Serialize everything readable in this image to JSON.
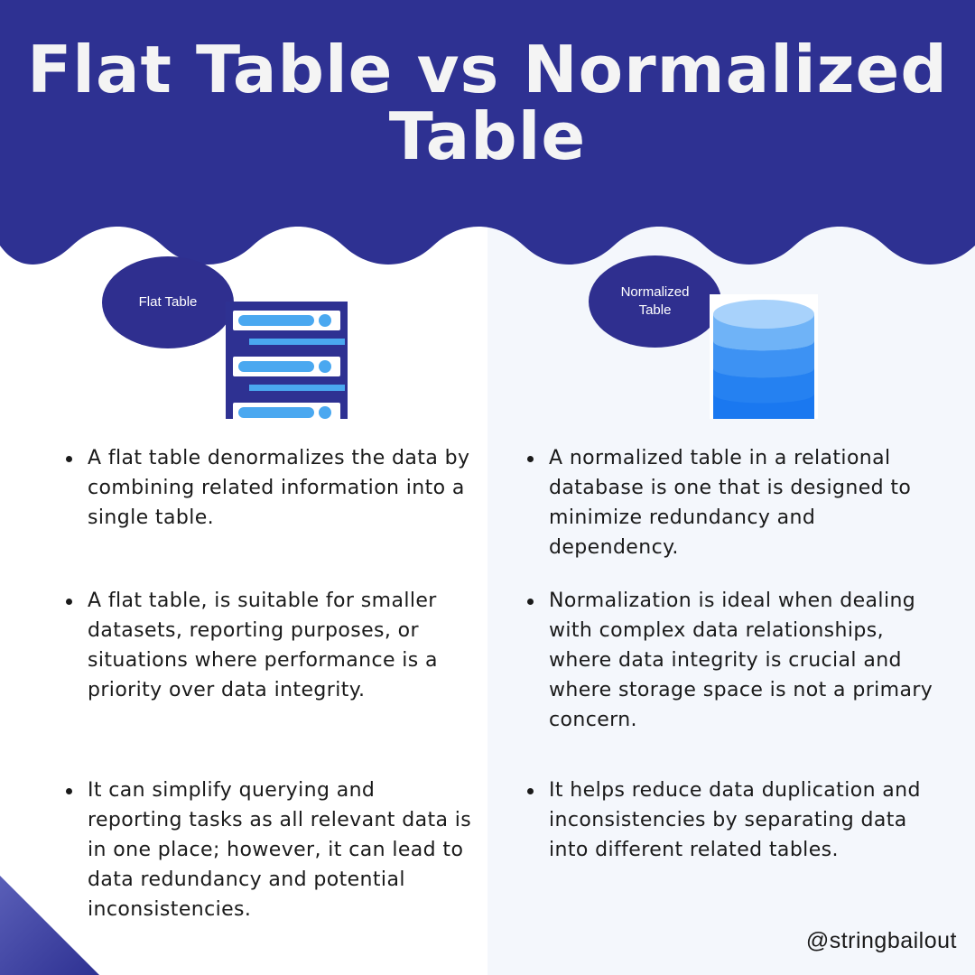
{
  "title": "Flat Table vs Normalized Table",
  "colors": {
    "header_bg": "#2e3192",
    "bubble_bg": "#2f2f8f",
    "right_panel_bg": "#f4f7fc",
    "server_frame": "#2e3192",
    "server_bar": "#4aa8f0",
    "db_top": "#a8d2fb",
    "db_body": "#1a78f0"
  },
  "left": {
    "label": "Flat Table",
    "icon": "server-rack-icon",
    "bullets": [
      "A flat table denormalizes the data by combining related information into a single table.",
      "A flat table, is suitable for smaller datasets, reporting purposes, or situations where performance is a priority over data integrity.",
      "It can simplify querying and reporting tasks as all relevant data is in one place; however, it can lead to data redundancy and potential inconsistencies."
    ]
  },
  "right": {
    "label": "Normalized Table",
    "icon": "database-icon",
    "bullets": [
      "A normalized table in a relational database is one that is designed to minimize redundancy and dependency.",
      "Normalization is ideal when dealing with complex data relationships, where data integrity is crucial and where storage space is not a primary concern.",
      "It helps reduce data duplication and inconsistencies by separating data into different related tables."
    ]
  },
  "handle": "@stringbailout"
}
